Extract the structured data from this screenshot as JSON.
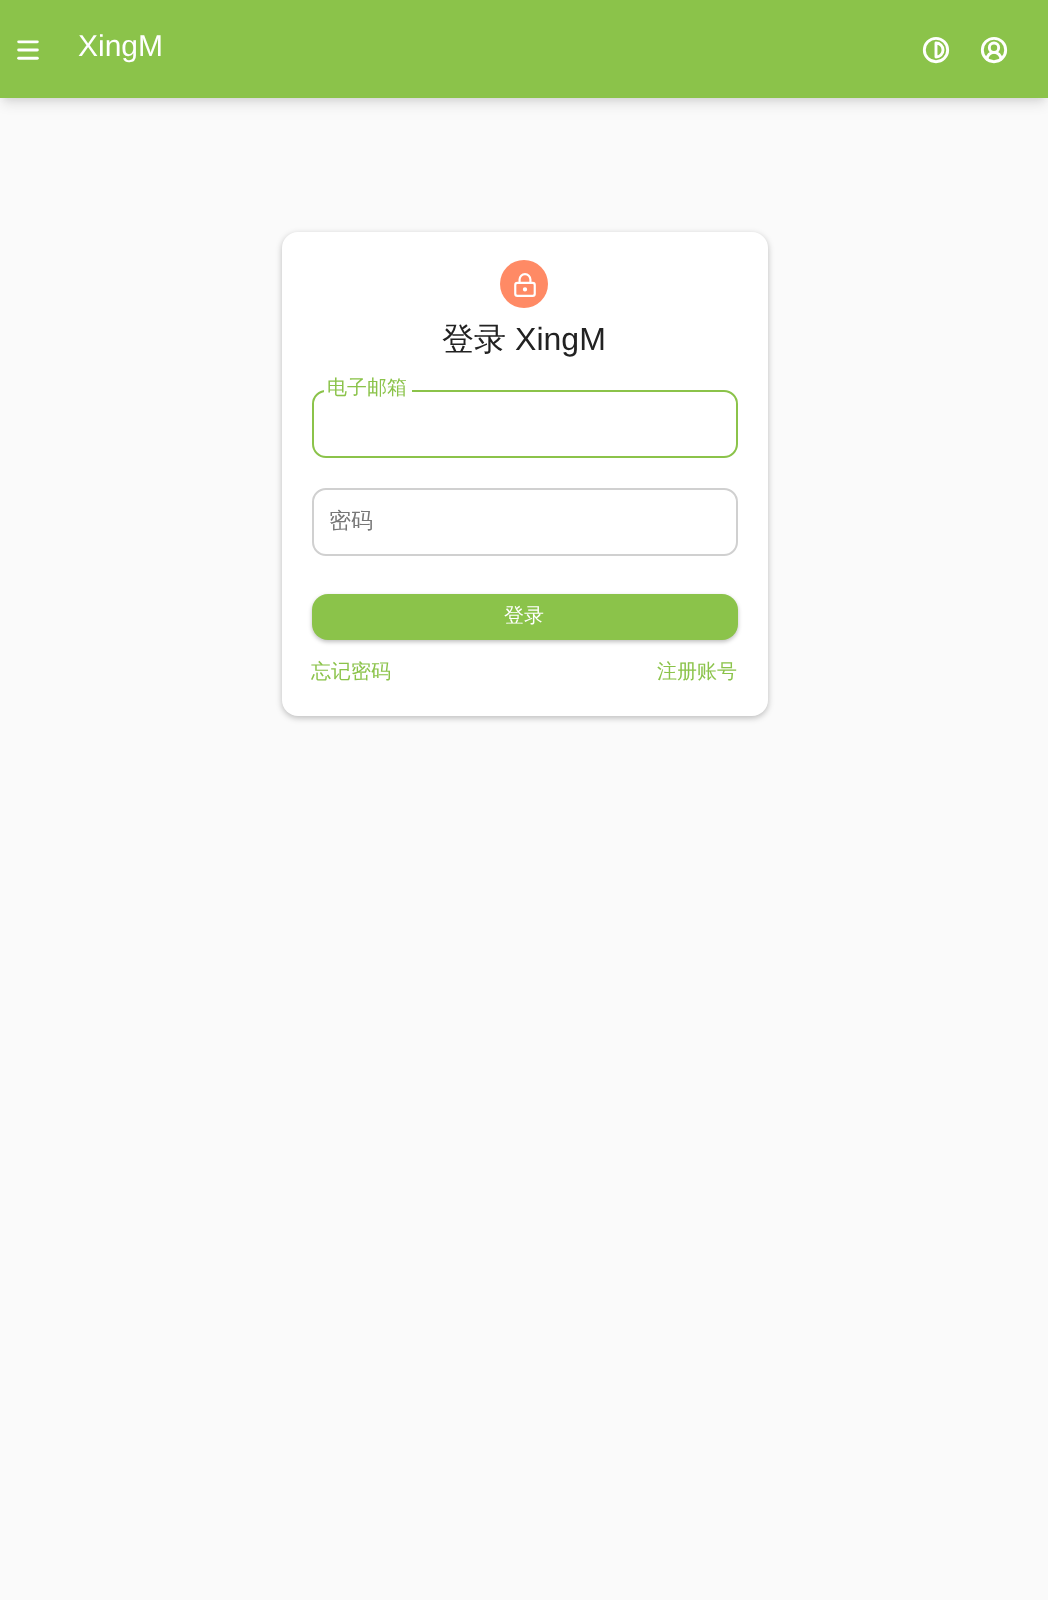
{
  "app_bar": {
    "title": "XingM"
  },
  "login_card": {
    "title": "登录 XingM",
    "fields": [
      {
        "label": "电子邮箱",
        "focused": true
      },
      {
        "label": "密码",
        "focused": false
      }
    ],
    "submit": "登录",
    "links": [
      "忘记密码",
      "注册账号"
    ]
  }
}
